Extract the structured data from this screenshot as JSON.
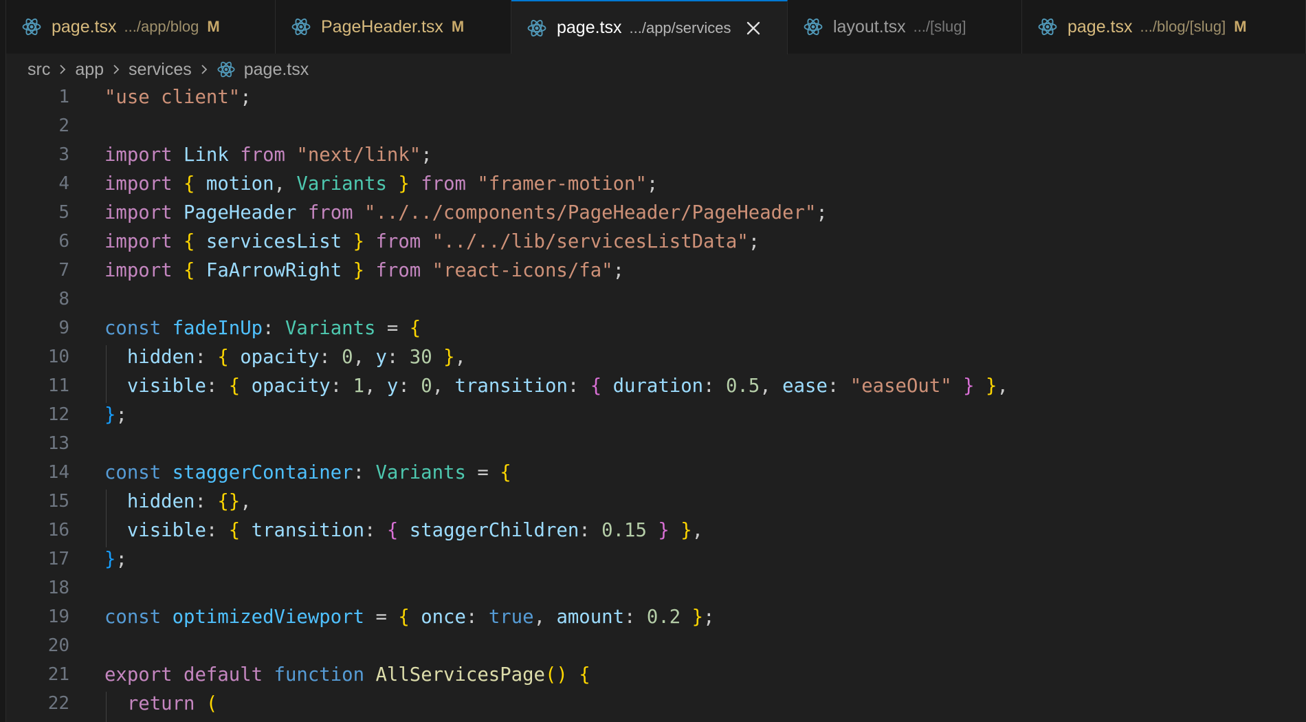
{
  "tabs": [
    {
      "name": "page.tsx",
      "description": ".../app/blog",
      "modified": "M"
    },
    {
      "name": "PageHeader.tsx",
      "description": "",
      "modified": "M"
    },
    {
      "name": "page.tsx",
      "description": ".../app/services",
      "active": true
    },
    {
      "name": "layout.tsx",
      "description": ".../[slug]",
      "modified": ""
    },
    {
      "name": "page.tsx",
      "description": ".../blog/[slug]",
      "modified": "M"
    }
  ],
  "breadcrumb": [
    "src",
    "app",
    "services",
    "page.tsx"
  ],
  "icons": {
    "file": "react-icon",
    "close": "close-icon",
    "separator": "chevron-right-icon"
  },
  "colors": {
    "keyword": "#c586c0",
    "storage": "#569cd6",
    "identifier": "#9cdcfe",
    "type": "#4ec9b0",
    "function": "#dcdcaa",
    "string": "#ce9178",
    "number": "#b5cea8",
    "accent": "#0078d4",
    "react": "#519aba"
  },
  "code": {
    "lines": [
      "\"use client\";",
      "",
      "import Link from \"next/link\";",
      "import { motion, Variants } from \"framer-motion\";",
      "import PageHeader from \"../../components/PageHeader/PageHeader\";",
      "import { servicesList } from \"../../lib/servicesListData\";",
      "import { FaArrowRight } from \"react-icons/fa\";",
      "",
      "const fadeInUp: Variants = {",
      "  hidden: { opacity: 0, y: 30 },",
      "  visible: { opacity: 1, y: 0, transition: { duration: 0.5, ease: \"easeOut\" } },",
      "};",
      "",
      "const staggerContainer: Variants = {",
      "  hidden: {},",
      "  visible: { transition: { staggerChildren: 0.15 } },",
      "};",
      "",
      "const optimizedViewport = { once: true, amount: 0.2 };",
      "",
      "export default function AllServicesPage() {",
      "  return ("
    ]
  }
}
